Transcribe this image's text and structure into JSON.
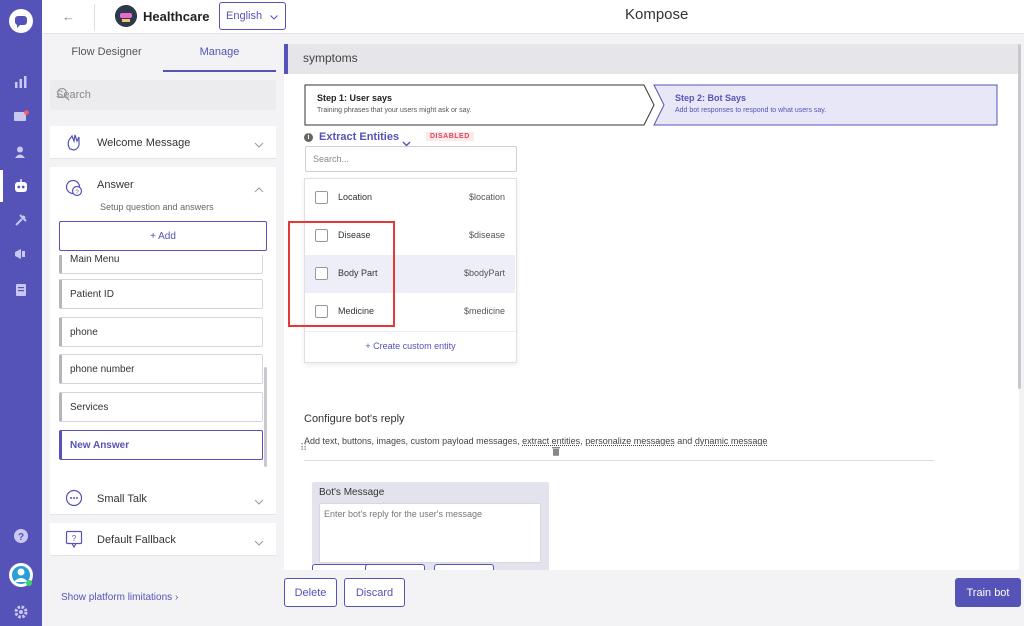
{
  "app": {
    "title": "Kompose",
    "bot_name": "Healthcare",
    "language": "English"
  },
  "left": {
    "tabs": [
      "Flow Designer",
      "Manage"
    ],
    "search_placeholder": "Search",
    "welcome": "Welcome Message",
    "answer": {
      "title": "Answer",
      "subtitle": "Setup question and answers",
      "add_label": "+ Add",
      "items": [
        "Main Menu",
        "Patient ID",
        "phone",
        "phone number",
        "Services",
        "New Answer"
      ]
    },
    "small_talk": "Small Talk",
    "default_fallback": "Default Fallback",
    "platform_limitations": "Show platform limitations"
  },
  "main": {
    "intent_name": "symptoms",
    "step1": {
      "title": "Step 1: User says",
      "desc": "Training phrases that your users might ask or say."
    },
    "step2": {
      "title": "Step 2: Bot Says",
      "desc": "Add bot responses to respond to what users say."
    },
    "extract_entities": "Extract Entities",
    "disabled_badge": "DISABLED",
    "entity_search_placeholder": "Search...",
    "entities": [
      {
        "name": "Location",
        "var": "$location"
      },
      {
        "name": "Disease",
        "var": "$disease"
      },
      {
        "name": "Body Part",
        "var": "$bodyPart"
      },
      {
        "name": "Medicine",
        "var": "$medicine"
      }
    ],
    "create_custom_entity": "+ Create custom entity",
    "configure_reply": "Configure bot's reply",
    "reply_desc": {
      "prefix": "Add text, buttons, images, custom payload messages,",
      "link1": "extract entities",
      "comma": ",",
      "link2": "personalize messages",
      "and": "and",
      "link3": "dynamic message"
    },
    "bot_message": {
      "title": "Bot's Message",
      "placeholder": "Enter bot's reply for the user's message"
    }
  },
  "footer": {
    "delete": "Delete",
    "discard": "Discard",
    "train": "Train bot"
  },
  "colors": {
    "accent": "#5553b7",
    "rail": "#5553b7",
    "danger": "#e53935",
    "disabled_badge": "#e0455a"
  }
}
